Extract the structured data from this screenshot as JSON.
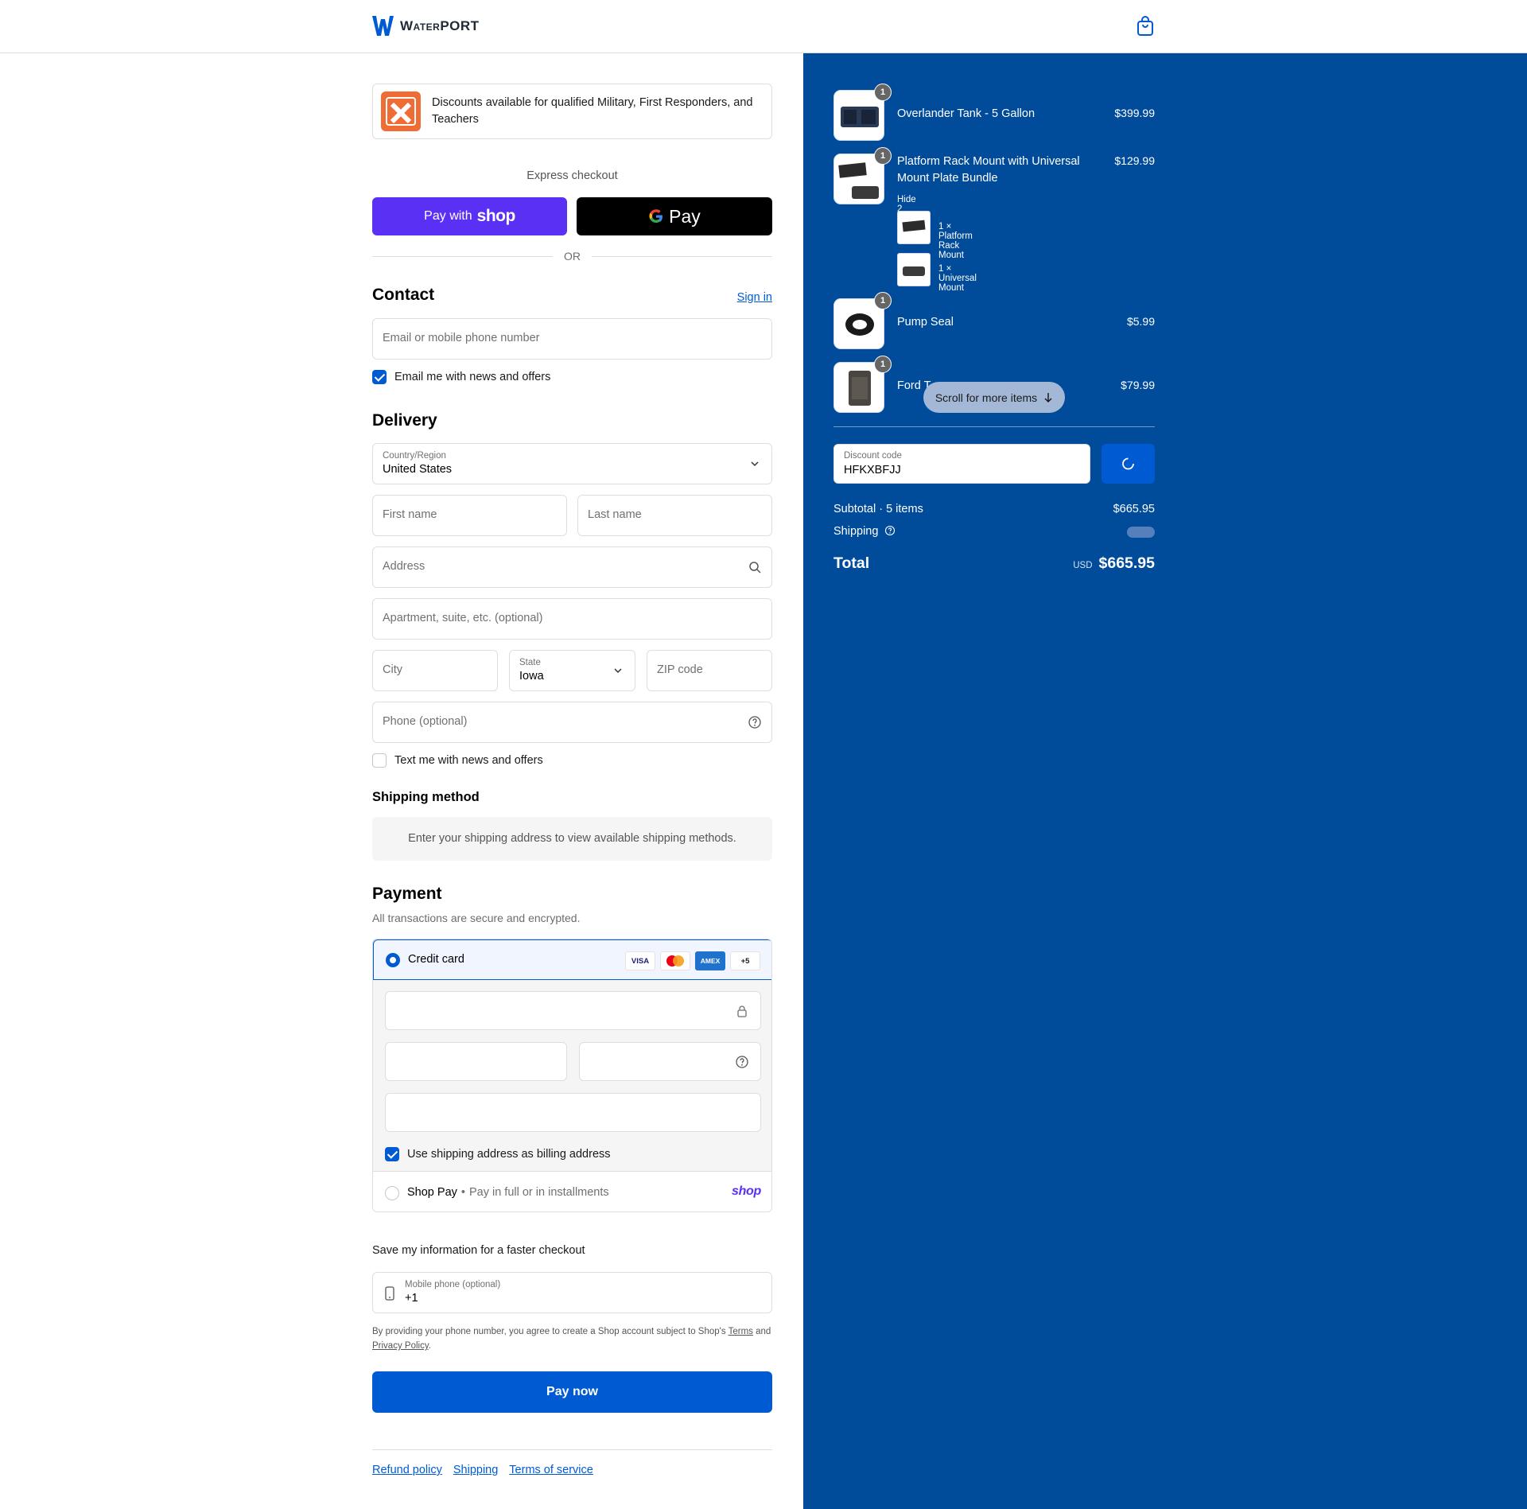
{
  "header": {
    "brand": "WaterPORT"
  },
  "banner": {
    "text": "Discounts available for qualified Military, First Responders, and Teachers"
  },
  "express": {
    "label": "Express checkout",
    "shop_prefix": "Pay with",
    "shop_word": "shop",
    "gpay_word": "Pay",
    "or": "OR"
  },
  "contact": {
    "title": "Contact",
    "sign_in": "Sign in",
    "email_placeholder": "Email or mobile phone number",
    "email_news_label": "Email me with news and offers",
    "email_news_checked": true
  },
  "delivery": {
    "title": "Delivery",
    "country_label": "Country/Region",
    "country_value": "United States",
    "first_name": "First name",
    "last_name": "Last name",
    "address": "Address",
    "apartment": "Apartment, suite, etc. (optional)",
    "city": "City",
    "state_label": "State",
    "state_value": "Iowa",
    "zip": "ZIP code",
    "phone": "Phone (optional)",
    "text_news_label": "Text me with news and offers",
    "text_news_checked": false
  },
  "shipping": {
    "title": "Shipping method",
    "message": "Enter your shipping address to view available shipping methods."
  },
  "payment": {
    "title": "Payment",
    "subtitle": "All transactions are secure and encrypted.",
    "credit_card_label": "Credit card",
    "card_icons": [
      "VISA",
      "mastercard",
      "AMEX",
      "+5"
    ],
    "billing_label": "Use shipping address as billing address",
    "billing_checked": true,
    "shop_pay_label": "Shop Pay",
    "shop_pay_desc": "Pay in full or in installments",
    "shop_pay_logo": "shop"
  },
  "save_info": {
    "title": "Save my information for a faster checkout",
    "phone_label": "Mobile phone (optional)",
    "phone_value": "+1",
    "disclaimer_pre": "By providing your phone number, you agree to create a Shop account subject to Shop's",
    "terms": "Terms",
    "and": "and",
    "privacy": "Privacy Policy",
    "period": "."
  },
  "pay_now": "Pay now",
  "footer": {
    "links": [
      "Refund policy",
      "Shipping",
      "Terms of service"
    ]
  },
  "summary": {
    "items": [
      {
        "name": "Overlander Tank - 5 Gallon",
        "price": "$399.99",
        "qty": "1"
      },
      {
        "name": "Platform Rack Mount with Universal Mount Plate Bundle",
        "price": "$129.99",
        "qty": "1",
        "toggle": "Hide 2 items",
        "sub_items": [
          "1 × Platform Rack Mount",
          "1 × Universal Mount"
        ]
      },
      {
        "name": "Pump Seal",
        "price": "$5.99",
        "qty": "1"
      },
      {
        "name": "Ford T",
        "price": "$79.99",
        "qty": "1"
      }
    ],
    "scroll_hint": "Scroll for more items",
    "discount_label": "Discount code",
    "discount_value": "HFKXBFJJ",
    "subtotal_label": "Subtotal · 5 items",
    "subtotal_value": "$665.95",
    "shipping_label": "Shipping",
    "total_label": "Total",
    "currency": "USD",
    "total_value": "$665.95"
  },
  "colors": {
    "accent": "#005bd3",
    "summary_bg": "#004c9b",
    "shop_purple": "#5a31f4"
  }
}
